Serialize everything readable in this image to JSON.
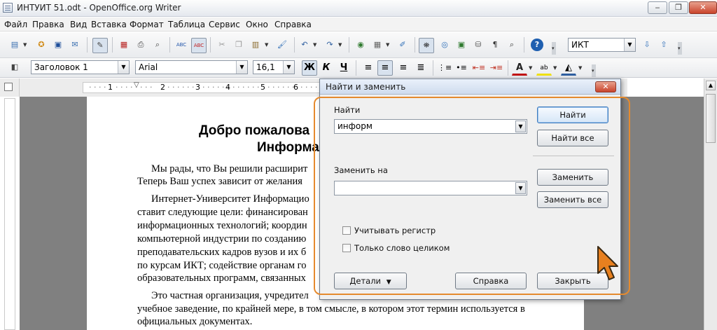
{
  "window": {
    "title": "ИНТУИТ 51.odt - OpenOffice.org Writer",
    "minimize": "‒",
    "maximize": "❐",
    "close": "✕"
  },
  "menu": [
    "Файл",
    "Правка",
    "Вид",
    "Вставка",
    "Формат",
    "Таблица",
    "Сервис",
    "Окно",
    "Справка"
  ],
  "toolbar": {
    "search_value": "ИКТ",
    "style": "Заголовок 1",
    "font": "Arial",
    "size": "16,1",
    "bold": "Ж",
    "italic": "К",
    "underline": "Ч"
  },
  "ruler": {
    "marks": [
      "1",
      "2",
      "3",
      "4",
      "5",
      "6"
    ]
  },
  "document": {
    "heading_line1": "Добро пожалова",
    "heading_line2": "Информа",
    "paragraphs": [
      "Мы рады, что Вы решили расширит",
      "Теперь Ваш успех зависит от желания",
      "Интернет-Университет Информацио",
      "ставит следующие цели: финансирован",
      "информационных технологий; координ",
      "компьютерной индустрии по созданию",
      "преподавательских кадров вузов и их б",
      "по курсам ИКТ; содействие органам го",
      "образовательных программ, связанных",
      "Это частная организация, учредител",
      "учебное заведение, по крайней мере, в том смысле, в котором этот термин используется в",
      "официальных документах."
    ]
  },
  "dialog": {
    "title": "Найти и заменить",
    "close": "✕",
    "find_label": "Найти",
    "find_value": "информ",
    "replace_label": "Заменить на",
    "replace_value": "",
    "buttons": {
      "find": "Найти",
      "find_all": "Найти все",
      "replace": "Заменить",
      "replace_all": "Заменить все",
      "details": "Детали",
      "help": "Справка",
      "close": "Закрыть"
    },
    "checkboxes": {
      "match_case": "Учитывать регистр",
      "whole_word": "Только слово целиком"
    }
  },
  "colors": {
    "highlight": "#e58a2e",
    "accent": "#3d7bbf"
  }
}
